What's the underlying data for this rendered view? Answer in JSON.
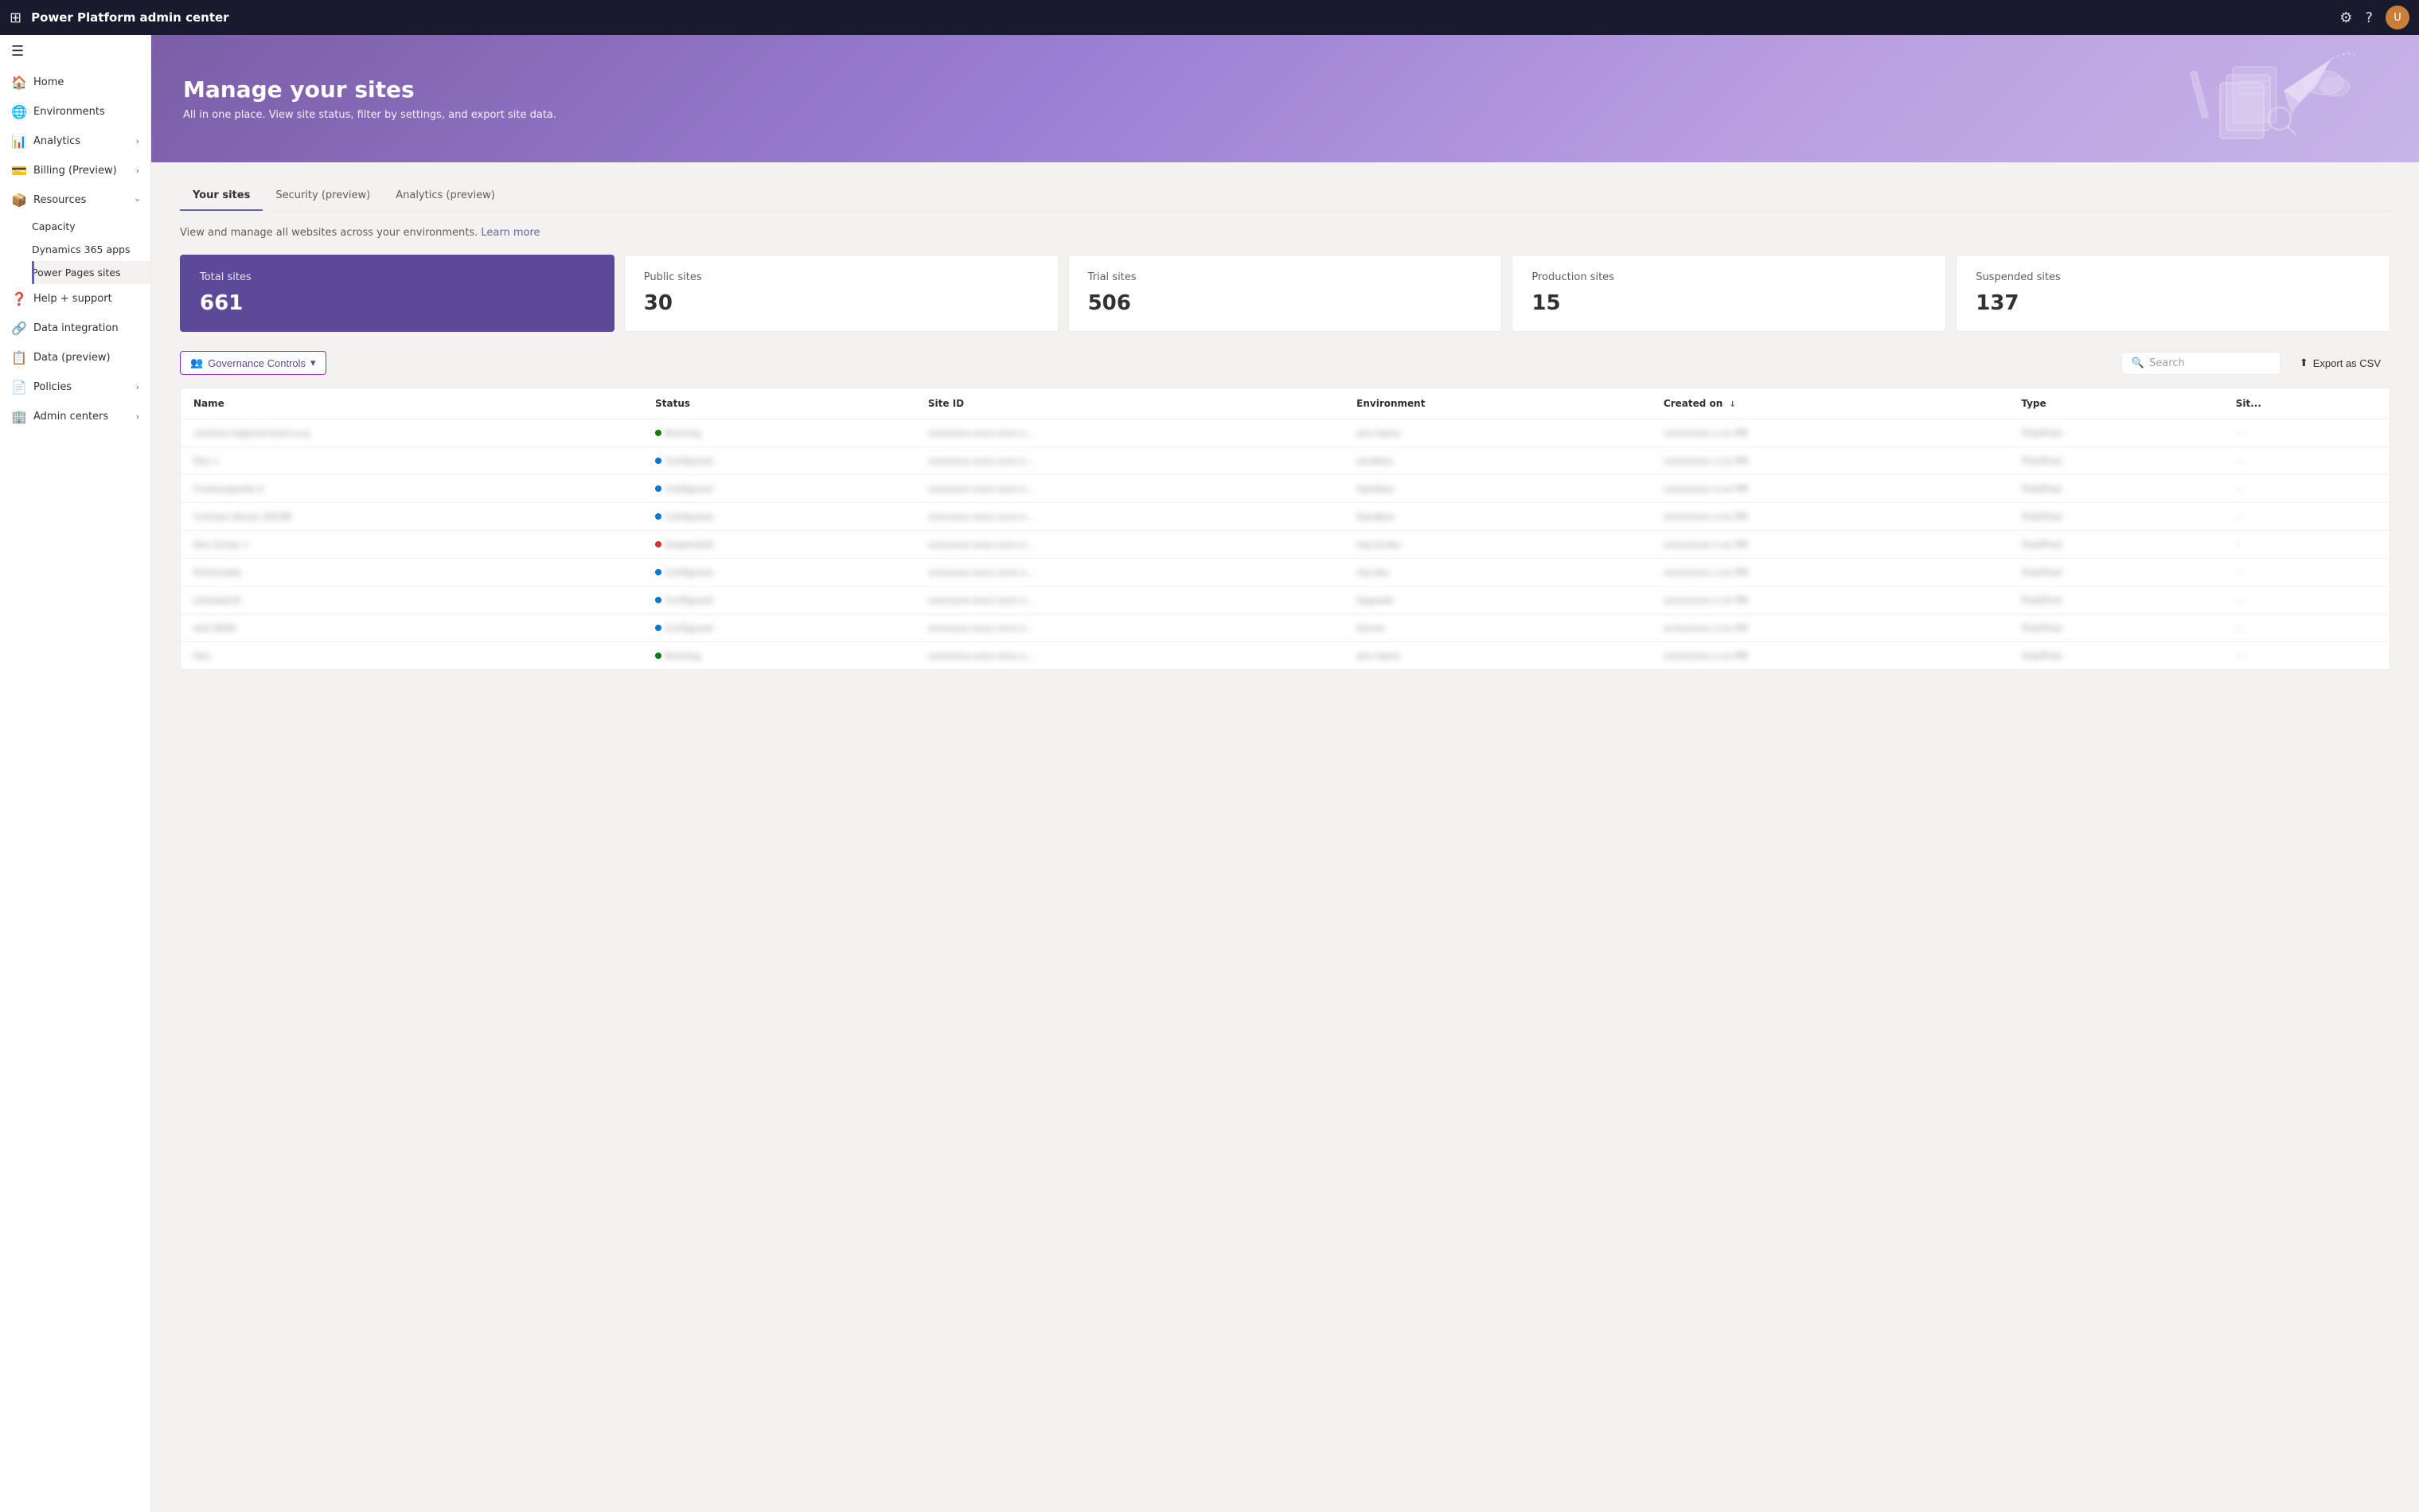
{
  "topbar": {
    "title": "Power Platform admin center",
    "waffle_icon": "⊞",
    "settings_icon": "⚙",
    "help_icon": "?",
    "avatar_text": "U"
  },
  "sidebar": {
    "hamburger_icon": "☰",
    "items": [
      {
        "id": "home",
        "label": "Home",
        "icon": "🏠",
        "expandable": false
      },
      {
        "id": "environments",
        "label": "Environments",
        "icon": "🌐",
        "expandable": false
      },
      {
        "id": "analytics",
        "label": "Analytics",
        "icon": "📊",
        "expandable": true
      },
      {
        "id": "billing",
        "label": "Billing (Preview)",
        "icon": "💳",
        "expandable": true
      },
      {
        "id": "resources",
        "label": "Resources",
        "icon": "📦",
        "expandable": true
      },
      {
        "id": "capacity",
        "label": "Capacity",
        "icon": "",
        "sub": true
      },
      {
        "id": "dynamics365",
        "label": "Dynamics 365 apps",
        "icon": "",
        "sub": true
      },
      {
        "id": "powerpages",
        "label": "Power Pages sites",
        "icon": "",
        "sub": true,
        "active": true
      },
      {
        "id": "helpsupport",
        "label": "Help + support",
        "icon": "❓",
        "expandable": false
      },
      {
        "id": "dataintegration",
        "label": "Data integration",
        "icon": "🔗",
        "expandable": false
      },
      {
        "id": "datapreview",
        "label": "Data (preview)",
        "icon": "📋",
        "expandable": false
      },
      {
        "id": "policies",
        "label": "Policies",
        "icon": "📄",
        "expandable": true
      },
      {
        "id": "admincenters",
        "label": "Admin centers",
        "icon": "🏢",
        "expandable": true
      }
    ]
  },
  "hero": {
    "title": "Manage your sites",
    "subtitle": "All in one place. View site status, filter by settings, and export site data."
  },
  "tabs": [
    {
      "id": "your-sites",
      "label": "Your sites",
      "active": true
    },
    {
      "id": "security",
      "label": "Security (preview)",
      "active": false
    },
    {
      "id": "analytics",
      "label": "Analytics (preview)",
      "active": false
    }
  ],
  "info": {
    "text": "View and manage all websites across your environments.",
    "link_text": "Learn more"
  },
  "stats": [
    {
      "label": "Total sites",
      "value": "661",
      "highlighted": true
    },
    {
      "label": "Public sites",
      "value": "30",
      "highlighted": false
    },
    {
      "label": "Trial sites",
      "value": "506",
      "highlighted": false
    },
    {
      "label": "Production sites",
      "value": "15",
      "highlighted": false
    },
    {
      "label": "Suspended sites",
      "value": "137",
      "highlighted": false
    }
  ],
  "toolbar": {
    "governance_label": "Governance Controls",
    "governance_icon": "👥",
    "chevron_icon": "▾",
    "search_placeholder": "Search",
    "search_icon": "🔍",
    "export_label": "Export as CSV",
    "export_icon": "⬆"
  },
  "table": {
    "columns": [
      {
        "id": "name",
        "label": "Name",
        "sortable": false
      },
      {
        "id": "status",
        "label": "Status",
        "sortable": false
      },
      {
        "id": "site_id",
        "label": "Site ID",
        "sortable": false
      },
      {
        "id": "environment",
        "label": "Environment",
        "sortable": false
      },
      {
        "id": "created_on",
        "label": "Created on",
        "sortable": true
      },
      {
        "id": "type",
        "label": "Type",
        "sortable": false
      },
      {
        "id": "site_col",
        "label": "Sit...",
        "sortable": false
      }
    ],
    "rows": [
      {
        "name": "blurred-1",
        "status": "running",
        "status_label": "Running",
        "site_id": "blurred",
        "environment": "blurred",
        "created_on": "blurred",
        "type": "blurred"
      },
      {
        "name": "blurred-2",
        "status": "configured",
        "status_label": "Configured",
        "site_id": "blurred",
        "environment": "blurred",
        "created_on": "blurred",
        "type": "blurred"
      },
      {
        "name": "blurred-3",
        "status": "configured",
        "status_label": "Configured",
        "site_id": "blurred",
        "environment": "blurred",
        "created_on": "blurred",
        "type": "blurred"
      },
      {
        "name": "blurred-4",
        "status": "configured",
        "status_label": "Configured",
        "site_id": "blurred",
        "environment": "blurred",
        "created_on": "blurred",
        "type": "blurred"
      },
      {
        "name": "blurred-5",
        "status": "suspended",
        "status_label": "Suspended",
        "site_id": "blurred",
        "environment": "blurred",
        "created_on": "blurred",
        "type": "blurred"
      },
      {
        "name": "blurred-6",
        "status": "configured",
        "status_label": "Configured",
        "site_id": "blurred",
        "environment": "blurred",
        "created_on": "blurred",
        "type": "blurred"
      },
      {
        "name": "blurred-7",
        "status": "configured",
        "status_label": "Configured",
        "site_id": "blurred",
        "environment": "blurred",
        "created_on": "blurred",
        "type": "blurred"
      },
      {
        "name": "blurred-8",
        "status": "configured",
        "status_label": "Configured",
        "site_id": "blurred",
        "environment": "blurred",
        "created_on": "blurred",
        "type": "blurred"
      },
      {
        "name": "blurred-9",
        "status": "running",
        "status_label": "Running",
        "site_id": "blurred",
        "environment": "blurred",
        "created_on": "blurred",
        "type": "blurred"
      }
    ]
  }
}
